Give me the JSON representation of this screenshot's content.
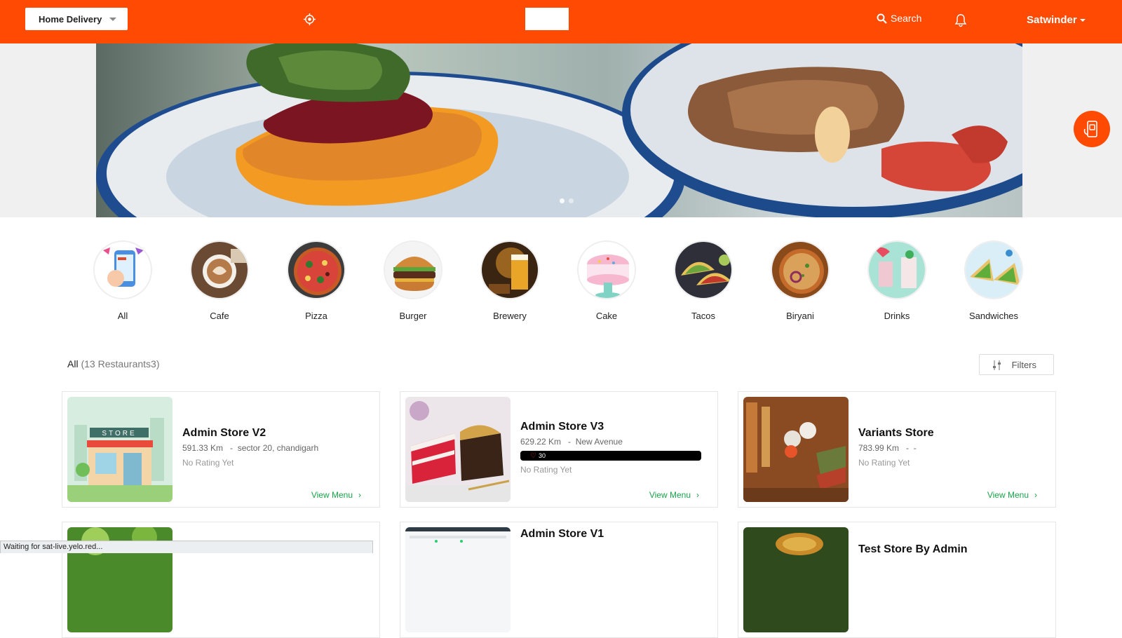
{
  "header": {
    "delivery_mode": "Home Delivery",
    "search_label": "Search",
    "user_name": "Satwinder"
  },
  "banner": {
    "slides": 2,
    "active_slide": 1
  },
  "categories": [
    {
      "label": "All"
    },
    {
      "label": "Cafe"
    },
    {
      "label": "Pizza"
    },
    {
      "label": "Burger"
    },
    {
      "label": "Brewery"
    },
    {
      "label": "Cake"
    },
    {
      "label": "Tacos"
    },
    {
      "label": "Biryani"
    },
    {
      "label": "Drinks"
    },
    {
      "label": "Sandwiches"
    }
  ],
  "list": {
    "title": "All",
    "count": "(13 Restaurants3)",
    "filters_label": "Filters"
  },
  "restaurants": [
    {
      "name": "Admin Store V2",
      "distance": "591.33 Km",
      "address": "sector 20, chandigarh",
      "rating": "No Rating Yet",
      "view_menu": "View Menu"
    },
    {
      "name": "Admin Store V3",
      "distance": "629.22 Km",
      "address": "New Avenue",
      "loyalty": "30",
      "rating": "No Rating Yet",
      "view_menu": "View Menu"
    },
    {
      "name": "Variants Store",
      "distance": "783.99 Km",
      "address": "-",
      "rating": "No Rating Yet",
      "view_menu": "View Menu"
    },
    {
      "name": "",
      "distance": "",
      "address": ""
    },
    {
      "name": "Admin Store V1",
      "distance": "",
      "address": ""
    },
    {
      "name": "Test Store By Admin",
      "distance": "",
      "address": ""
    }
  ],
  "status_bar": "Waiting for sat-live.yelo.red..."
}
